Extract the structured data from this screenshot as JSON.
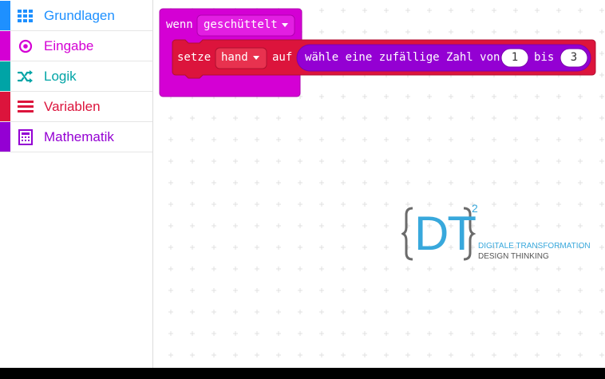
{
  "sidebar": {
    "items": [
      {
        "label": "Grundlagen",
        "icon": "grid-icon",
        "color": "#1E90FF"
      },
      {
        "label": "Eingabe",
        "icon": "target-icon",
        "color": "#D400D4"
      },
      {
        "label": "Logik",
        "icon": "shuffle-icon",
        "color": "#00A4A6"
      },
      {
        "label": "Variablen",
        "icon": "list-icon",
        "color": "#DC143C"
      },
      {
        "label": "Mathematik",
        "icon": "calculator-icon",
        "color": "#9400D3"
      }
    ]
  },
  "blocks": {
    "event": {
      "keyword": "wenn",
      "dropdown": "geschüttelt",
      "color": "#D400D4"
    },
    "set": {
      "keyword": "setze",
      "variable": "hand",
      "connector": "auf",
      "color": "#DC143C"
    },
    "random": {
      "text": "wähle eine zufällige Zahl von",
      "from": "1",
      "to_label": "bis",
      "to": "3",
      "color": "#9400D3"
    }
  },
  "logo": {
    "letters": "DT",
    "superscript": "2",
    "line1": "DIGITALE TRANSFORMATION",
    "line2": "DESIGN THINKING"
  }
}
